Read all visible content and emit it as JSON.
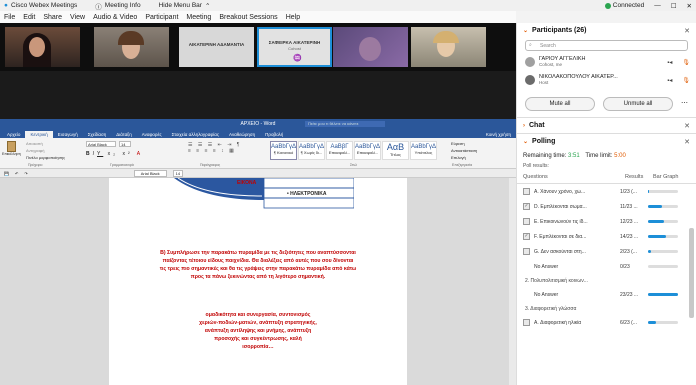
{
  "app": {
    "title": "Cisco Webex Meetings",
    "meeting_info": "Meeting Info",
    "hide_menu": "Hide Menu Bar",
    "status": "Connected"
  },
  "menu": [
    "File",
    "Edit",
    "Share",
    "View",
    "Audio & Video",
    "Participant",
    "Meeting",
    "Breakout Sessions",
    "Help"
  ],
  "video_tiles": [
    {
      "name": ""
    },
    {
      "name": ""
    },
    {
      "name": "ΑΙΚΑΤΕΡΙΝΗ ΑΔΑΜΑΝΤΙΑ",
      "sub": ""
    },
    {
      "name": "ΣΑΦΕΙΡΚΑ ΑΙΚΑΤΕΡΙΝΗ",
      "sub": "Cohost"
    },
    {
      "name": ""
    },
    {
      "name": ""
    }
  ],
  "word": {
    "title": "ΑΡΧΕΙΟ - Word",
    "search": "Πείτε μου τι θέλετε να κάνετε",
    "share": "Κοινή χρήση",
    "tabs": [
      "Αρχείο",
      "Κεντρική",
      "Εισαγωγή",
      "Σχεδίαση",
      "Διάταξη",
      "Αναφορές",
      "Στοιχεία αλληλογραφίας",
      "Αναθεώρηση",
      "Προβολή"
    ],
    "font": "Arial Black",
    "font_size": "14",
    "styles": [
      {
        "sample": "AaBbΓγΔ",
        "name": "¶ Κανονικό"
      },
      {
        "sample": "AaBbΓγΔ",
        "name": "¶ Χωρίς δι..."
      },
      {
        "sample": "AaBβΓ",
        "name": "Επικεφαλί..."
      },
      {
        "sample": "AaBbΓγΔ",
        "name": "Επικεφαλί..."
      },
      {
        "sample": "AαΒ",
        "name": "Τίτλος"
      },
      {
        "sample": "AaBbΓγΔ",
        "name": "Υπότιτλος"
      }
    ],
    "groups": [
      "Πρόχειρο",
      "Γραμματοσειρά",
      "Παράγραφος",
      "Στυλ",
      "Επεξεργασία"
    ],
    "clipboard": [
      "Επικόλληση",
      "Αποκοπή",
      "Αντιγραφή",
      "Πινέλο μορφοποίησης"
    ],
    "editing": [
      "Εύρεση",
      "Αντικατάσταση",
      "Επιλογή"
    ],
    "pyramid_label": "ΕΙΚΟΝΑ",
    "pyramid_item": "• ΗΛΕΚΤΡΟΝΙΚΑ",
    "para_b": "Β) Συμπλήρωσε την παρακάτω πυραμίδα με τις δεξιότητες που αναπτύσσονται παίζοντας τέτοιου είδους παιχνίδια. Θα διαλέξεις από αυτές που σου δίνονται τις τρεις πιο σημαντικές και θα τις γράψεις στην παρακάτω πυραμίδα από κάτω προς τα πάνω ξεκινώντας από τη λιγότερο σημαντική.",
    "skills": "ομαδικότητα και συνεργασία, συντονισμός χεριών-ποδιών-ματιών, ανάπτυξη στρατηγικής, ανάπτυξη αντίληψης και μνήμης, ανάπτυξη προσοχής και συγκέντρωσης, καλή ισορροπία…"
  },
  "participants": {
    "header": "Participants (26)",
    "search": "Search",
    "list": [
      {
        "name": "ΓΑΡΙΟΥ ΑΓΓΕΛΙΚΗ",
        "role": "Cohost, me"
      },
      {
        "name": "ΝΙΚΟΛΑΚΟΠΟΥΛΟΥ ΑΙΚΑΤΕΡ...",
        "role": "Host"
      }
    ],
    "mute_all": "Mute all",
    "unmute_all": "Unmute all"
  },
  "chat": {
    "header": "Chat"
  },
  "polling": {
    "header": "Polling",
    "remaining_label": "Remaining time:",
    "remaining": "3:51",
    "limit_label": "Time limit:",
    "limit": "5:00",
    "poll_results": "Poll results:",
    "col_questions": "Questions",
    "col_results": "Results",
    "col_bar": "Bar Graph",
    "rows": [
      {
        "kind": "ans",
        "text": "A. Χάνουν χρόνο, χω...",
        "res": "1/23 (...",
        "pct": 0.04,
        "checked": false
      },
      {
        "kind": "ans",
        "text": "D. Εμπλέκονται σωμα...",
        "res": "11/23 ...",
        "pct": 0.48,
        "checked": true
      },
      {
        "kind": "ans",
        "text": "E. Επικοινωνούν τις ίδ...",
        "res": "12/23 ...",
        "pct": 0.52,
        "checked": false
      },
      {
        "kind": "ans",
        "text": "F. Εμπλέκονται σε δια...",
        "res": "14/23 ...",
        "pct": 0.61,
        "checked": true
      },
      {
        "kind": "ans",
        "text": "G. Δεν ασκούνται στη...",
        "res": "2/23 (...",
        "pct": 0.09,
        "checked": false
      },
      {
        "kind": "ans",
        "text": "No Answer",
        "res": "0/23",
        "pct": 0.0,
        "checked": null
      },
      {
        "kind": "sec",
        "text": "2. Πολυπολιτισμική κοινων..."
      },
      {
        "kind": "ans",
        "text": "No Answer",
        "res": "23/23 ...",
        "pct": 1.0,
        "checked": null
      },
      {
        "kind": "sec",
        "text": "3. Διαφορετική γλώσσα"
      },
      {
        "kind": "ans",
        "text": "A. Διαφορετική ηλικία",
        "res": "6/23 (...",
        "pct": 0.26,
        "checked": false
      }
    ]
  },
  "colors": {
    "accent": "#e05a00",
    "word_blue": "#2b579a",
    "bar_blue": "#1d8fd8",
    "connected": "#2aa44f",
    "doc_red": "#c00000"
  }
}
